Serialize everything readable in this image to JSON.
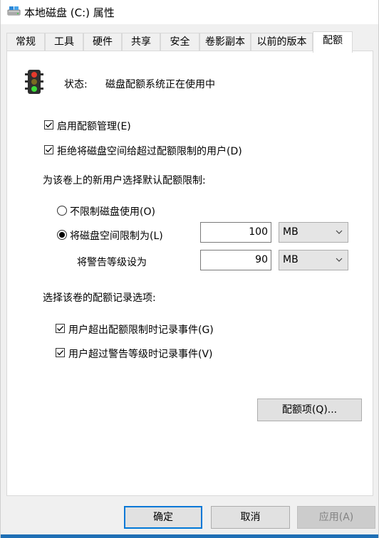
{
  "window": {
    "title": "本地磁盘 (C:) 属性",
    "icon": "drive-icon"
  },
  "tabs": [
    {
      "label": "常规"
    },
    {
      "label": "工具"
    },
    {
      "label": "硬件"
    },
    {
      "label": "共享"
    },
    {
      "label": "安全"
    },
    {
      "label": "卷影副本"
    },
    {
      "label": "以前的版本"
    },
    {
      "label": "配额"
    }
  ],
  "active_tab": "配额",
  "status": {
    "icon": "traffic-light-icon",
    "label": "状态:",
    "value": "磁盘配额系统正在使用中"
  },
  "options": {
    "enable_quota": {
      "label": "启用配额管理(E)",
      "checked": true
    },
    "deny_space": {
      "label": "拒绝将磁盘空间给超过配额限制的用户(D)",
      "checked": true
    }
  },
  "default_limit": {
    "heading": "为该卷上的新用户选择默认配额限制:",
    "no_limit_label": "不限制磁盘使用(O)",
    "limit_label": "将磁盘空间限制为(L)",
    "selected": "limit",
    "limit_value": "100",
    "limit_unit": "MB",
    "warning_label": "将警告等级设为",
    "warning_value": "90",
    "warning_unit": "MB"
  },
  "logging": {
    "heading": "选择该卷的配额记录选项:",
    "log_limit": {
      "label": "用户超出配额限制时记录事件(G)",
      "checked": true
    },
    "log_warning": {
      "label": "用户超过警告等级时记录事件(V)",
      "checked": true
    }
  },
  "buttons": {
    "quota_entries": "配额项(Q)...",
    "ok": "确定",
    "cancel": "取消",
    "apply": "应用(A)"
  },
  "colors": {
    "accent": "#0078d7",
    "disabled_text": "#838383"
  }
}
